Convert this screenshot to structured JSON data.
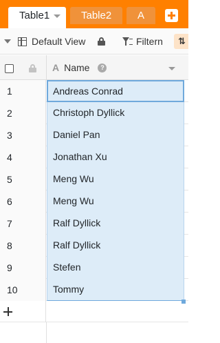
{
  "tabs": [
    {
      "label": "Table1",
      "active": true
    },
    {
      "label": "Table2",
      "active": false
    },
    {
      "label": "A",
      "active": false
    }
  ],
  "toolbar": {
    "view_label": "Default View",
    "filter_label": "Filtern",
    "sort_label": "⇅"
  },
  "columns": [
    {
      "name": "Name",
      "type_icon": "text-type-icon"
    }
  ],
  "rows": [
    {
      "num": "1",
      "name": "Andreas Conrad"
    },
    {
      "num": "2",
      "name": "Christoph Dyllick"
    },
    {
      "num": "3",
      "name": "Daniel Pan"
    },
    {
      "num": "4",
      "name": "Jonathan Xu"
    },
    {
      "num": "5",
      "name": "Meng Wu"
    },
    {
      "num": "6",
      "name": "Meng Wu"
    },
    {
      "num": "7",
      "name": "Ralf Dyllick"
    },
    {
      "num": "8",
      "name": "Ralf Dyllick"
    },
    {
      "num": "9",
      "name": "Stefen"
    },
    {
      "num": "10",
      "name": "Tommy"
    }
  ],
  "colors": {
    "brand": "#ff8000",
    "selection": "#ddecf8",
    "selection_border": "#6fa9dc"
  }
}
